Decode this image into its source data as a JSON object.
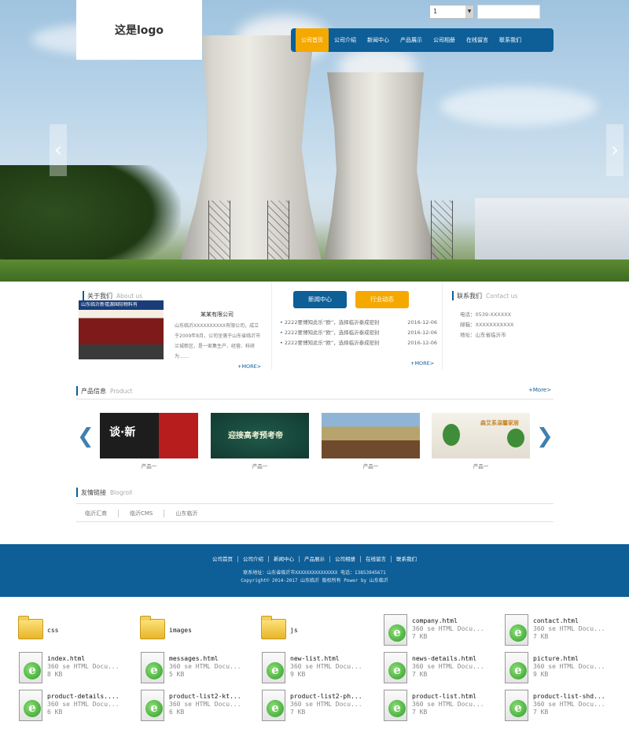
{
  "header": {
    "logo_text": "这是logo",
    "select_value": "1",
    "nav": [
      "公司首页",
      "公司介绍",
      "新闻中心",
      "产品展示",
      "公司相册",
      "在线留言",
      "联系我们"
    ],
    "active_nav_index": 0,
    "colors": {
      "primary": "#0e5e98",
      "accent": "#f5a800"
    }
  },
  "hero": {
    "arrow_left": "‹",
    "arrow_right": "›"
  },
  "about": {
    "title": "关于我们",
    "title_en": "About us",
    "image_caption": "山东临沂新禧源国际物料有",
    "company": "某某有限公司",
    "text": "山东临沂XXXXXXXXXX有限公司，成立于2009年8月，公司坐落于山东省临沂市兰城新区，是一家集生产、经营、科研为……",
    "more": "+MORE>"
  },
  "news": {
    "tab_news": "新闻中心",
    "tab_industry": "行业动态",
    "items": [
      {
        "title": "2222要博知此乐“欧”，选择临沂泰成密封",
        "date": "2016-12-06"
      },
      {
        "title": "2222要博知此乐“欧”，选择临沂泰成密封",
        "date": "2016-12-06"
      },
      {
        "title": "2222要博知此乐“欧”，选择临沂泰成密封",
        "date": "2016-12-06"
      }
    ],
    "more": "+MORE>"
  },
  "contact": {
    "title": "联系我们",
    "title_en": "Contact us",
    "phone": "电话：0539-XXXXXX",
    "email": "邮箱：XXXXXXXXXXX",
    "address": "地址：山东省临沂市"
  },
  "products": {
    "title": "产品信息",
    "title_en": "Product",
    "more": "+More>",
    "arrow_left": "❮",
    "arrow_right": "❯",
    "items": [
      {
        "caption": "产品一",
        "img_text": "谈·新"
      },
      {
        "caption": "产品一",
        "img_text": "迎接高考预考帝"
      },
      {
        "caption": "产品一",
        "img_text": ""
      },
      {
        "caption": "产品一",
        "img_text": "森艾系温馨家居"
      }
    ]
  },
  "links": {
    "title": "友情链接",
    "title_en": "Blogroll",
    "items": [
      "临沂汇商",
      "临沂CMS",
      "山东临沂"
    ]
  },
  "footer": {
    "nav": [
      "公司首页",
      "公司介绍",
      "新闻中心",
      "产品展示",
      "公司相册",
      "在线留言",
      "联系我们"
    ],
    "contact_line": "联系地址：山东省临沂市XXXXXXXXXXXXXXX 电话：13853945671",
    "copyright_line": "Copyright© 2014-2017 山东临沂 版权所有 Power by 山东临沂"
  },
  "explorer": {
    "files": [
      {
        "name": "css",
        "type": "folder"
      },
      {
        "name": "images",
        "type": "folder"
      },
      {
        "name": "js",
        "type": "folder"
      },
      {
        "name": "company.html",
        "desc": "360 se HTML Docu...",
        "size": "7 KB",
        "type": "html"
      },
      {
        "name": "contact.html",
        "desc": "360 se HTML Docu...",
        "size": "7 KB",
        "type": "html"
      },
      {
        "name": "index.html",
        "desc": "360 se HTML Docu...",
        "size": "8 KB",
        "type": "html"
      },
      {
        "name": "messages.html",
        "desc": "360 se HTML Docu...",
        "size": "5 KB",
        "type": "html"
      },
      {
        "name": "new-list.html",
        "desc": "360 se HTML Docu...",
        "size": "9 KB",
        "type": "html"
      },
      {
        "name": "news-details.html",
        "desc": "360 se HTML Docu...",
        "size": "7 KB",
        "type": "html"
      },
      {
        "name": "picture.html",
        "desc": "360 se HTML Docu...",
        "size": "9 KB",
        "type": "html"
      },
      {
        "name": "product-details....",
        "desc": "360 se HTML Docu...",
        "size": "6 KB",
        "type": "html"
      },
      {
        "name": "product-list2-kt...",
        "desc": "360 se HTML Docu...",
        "size": "6 KB",
        "type": "html"
      },
      {
        "name": "product-list2-ph...",
        "desc": "360 se HTML Docu...",
        "size": "7 KB",
        "type": "html"
      },
      {
        "name": "product-list.html",
        "desc": "360 se HTML Docu...",
        "size": "7 KB",
        "type": "html"
      },
      {
        "name": "product-list-shd...",
        "desc": "360 se HTML Docu...",
        "size": "7 KB",
        "type": "html"
      }
    ]
  }
}
